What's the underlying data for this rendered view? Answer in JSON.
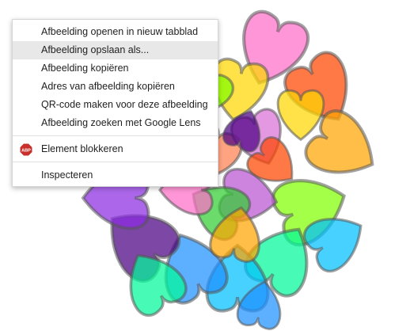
{
  "context_menu": {
    "items": [
      {
        "label": "Afbeelding openen in nieuw tabblad"
      },
      {
        "label": "Afbeelding opslaan als...",
        "highlighted": true
      },
      {
        "label": "Afbeelding kopiëren"
      },
      {
        "label": "Adres van afbeelding kopiëren"
      },
      {
        "label": "QR-code maken voor deze afbeelding"
      },
      {
        "label": "Afbeelding zoeken met Google Lens"
      }
    ],
    "extension_item": {
      "label": "Element blokkeren",
      "icon": "adblock-plus-icon",
      "icon_text": "ABP",
      "icon_color": "#c9302c"
    },
    "inspect_item": {
      "label": "Inspecteren"
    }
  },
  "background_image": {
    "subject": "overlapping colorful hearts",
    "colors": [
      "#ff6ec7",
      "#ff4500",
      "#ffa500",
      "#ffd700",
      "#7fff00",
      "#00fa9a",
      "#00bfff",
      "#1e90ff",
      "#4b0082",
      "#8a2be2",
      "#ff1493",
      "#ff7f50",
      "#da70d6",
      "#ba55d3",
      "#32cd32"
    ]
  }
}
